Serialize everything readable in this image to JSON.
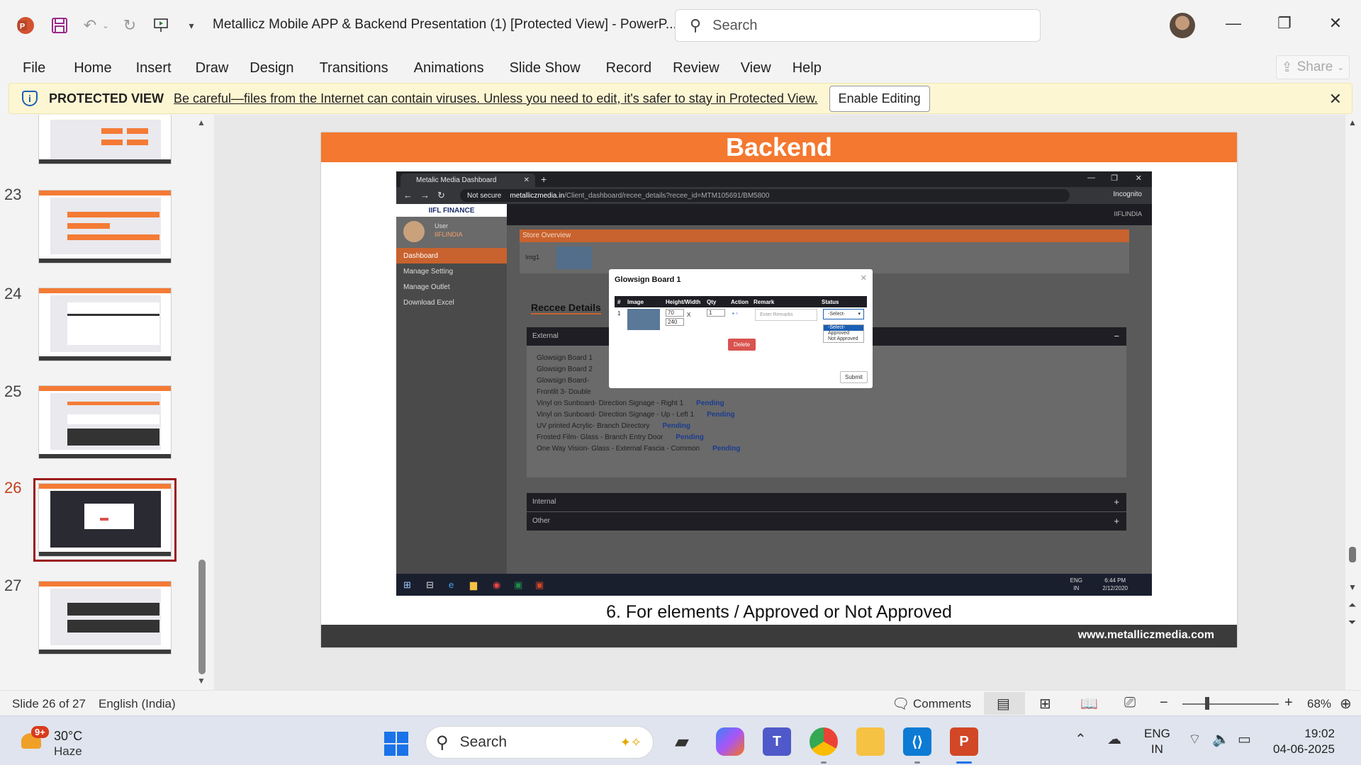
{
  "window": {
    "doc_title": "Metallicz Mobile APP & Backend Presentation (1) [Protected View]  -  PowerP...",
    "search_placeholder": "Search"
  },
  "ribbon": {
    "tabs": [
      "File",
      "Home",
      "Insert",
      "Draw",
      "Design",
      "Transitions",
      "Animations",
      "Slide Show",
      "Record",
      "Review",
      "View",
      "Help"
    ],
    "share_label": "Share"
  },
  "protected_view": {
    "label": "PROTECTED VIEW",
    "message": "Be careful—files from the Internet can contain viruses. Unless you need to edit, it's safer to stay in Protected View.",
    "button": "Enable Editing"
  },
  "thumbnails": {
    "numbers": [
      "23",
      "24",
      "25",
      "26",
      "27"
    ],
    "selected": "26"
  },
  "slide": {
    "header": "Backend",
    "caption": "6. For elements / Approved or Not Approved",
    "footer_url": "www.metalliczmedia.com"
  },
  "browser": {
    "tab_title": "Metalic Media Dashboard",
    "not_secure": "Not secure",
    "url_domain": "metalliczmedia.in",
    "url_path": "/Client_dashboard/recee_details?recee_id=MTM105691/BM5800",
    "incognito": "Incognito"
  },
  "app": {
    "logo": "IIFL FINANCE",
    "user_name": "User",
    "user_role": "IIFLINDIA",
    "top_user": "IIFLINDIA",
    "menu": [
      "Dashboard",
      "Manage Setting",
      "Manage Outlet",
      "Download Excel"
    ],
    "store_overview": "Store Overview",
    "img_label": "Img1",
    "reccee_title": "Reccee Details",
    "sections": [
      "External",
      "Internal",
      "Other"
    ],
    "external_items": [
      {
        "name": "Glowsign Board 1",
        "status": ""
      },
      {
        "name": "Glowsign Board 2",
        "status": ""
      },
      {
        "name": "Glowsign Board-",
        "status": ""
      },
      {
        "name": "Frontlit 3- Double",
        "status": ""
      },
      {
        "name": "Vinyl on Sunboard- Direction Signage - Right 1",
        "status": "Pending"
      },
      {
        "name": "Vinyl on Sunboard- Direction Signage - Up - Left 1",
        "status": "Pending"
      },
      {
        "name": "UV printed Acrylic- Branch Directory",
        "status": "Pending"
      },
      {
        "name": "Frosted Film- Glass - Branch Entry Door",
        "status": "Pending"
      },
      {
        "name": "One Way Vision- Glass - External Fascia - Common",
        "status": "Pending"
      }
    ]
  },
  "modal": {
    "title": "Glowsign Board 1",
    "columns": [
      "#",
      "Image",
      "Height/Width",
      "Qty",
      "Action",
      "Remark",
      "Status"
    ],
    "row": {
      "num": "1",
      "height": "70",
      "x": "X",
      "width": "240",
      "qty": "1",
      "remark_placeholder": "Enter Remarks",
      "status_value": "-Select-"
    },
    "status_options": [
      "-Select-",
      "Approved",
      "Not Approved"
    ],
    "delete_label": "Delete",
    "submit_label": "Submit"
  },
  "inner_taskbar": {
    "lang1": "ENG",
    "lang2": "IN",
    "time": "6:44 PM",
    "date": "2/12/2020"
  },
  "statusbar": {
    "slide_info": "Slide 26 of 27",
    "language": "English (India)",
    "comments": "Comments",
    "zoom": "68%"
  },
  "taskbar": {
    "weather_temp": "30°C",
    "weather_desc": "Haze",
    "weather_badge": "9+",
    "search_label": "Search",
    "lang1": "ENG",
    "lang2": "IN",
    "time": "19:02",
    "date": "04-06-2025"
  },
  "colors": {
    "accent_orange": "#f4782f",
    "powerpoint_red": "#c43e1c",
    "protected_bar": "#fdf6d3"
  }
}
